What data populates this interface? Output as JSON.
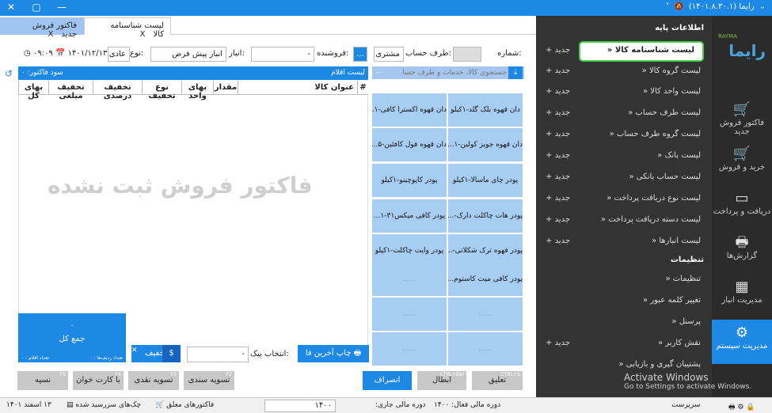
{
  "titlebar": {
    "user": "رایما (۱۴۰۱.۸.۳۰.۱)",
    "icons": [
      "chevron-down-icon",
      "bell-off-icon",
      "chevron-down-small-icon"
    ],
    "window_controls": {
      "close": "✕",
      "maximize": "▢",
      "minimize": "—"
    }
  },
  "logo": {
    "sub": "RAYMA",
    "main": "رایما"
  },
  "rail": [
    {
      "id": "new-invoice",
      "label": "فاکتور فروش جدید",
      "icon": "cart-plus-icon",
      "glyph": "🛒"
    },
    {
      "id": "buy-sell",
      "label": "خرید و فروش",
      "icon": "cart-icon",
      "glyph": "🛒"
    },
    {
      "id": "receive-pay",
      "label": "دریافت و پرداخت",
      "icon": "card-icon",
      "glyph": "▭"
    },
    {
      "id": "reports",
      "label": "گزارش‌ها",
      "icon": "printer-icon",
      "glyph": "🖶"
    },
    {
      "id": "warehouse",
      "label": "مدیریت انبار",
      "icon": "grid-icon",
      "glyph": "▦"
    },
    {
      "id": "system",
      "label": "مدیریت سیستم",
      "icon": "gear-icon",
      "glyph": "⚙"
    }
  ],
  "menu": {
    "section1": "اطلاعات پایه",
    "section2": "تنظیمات",
    "new_label": "جدید",
    "items": [
      {
        "label": "لیست شناسنامه کالا",
        "new": true,
        "selected": true
      },
      {
        "label": "لیست گروه کالا",
        "new": true
      },
      {
        "label": "لیست واحد کالا",
        "new": true
      },
      {
        "label": "لیست طرف حساب",
        "new": true
      },
      {
        "label": "لیست گروه طرف حساب",
        "new": true
      },
      {
        "label": "لیست بانک",
        "new": true
      },
      {
        "label": "لیست حساب بانکی",
        "new": true
      },
      {
        "label": "لیست نوع دریافت پرداخت",
        "new": true
      },
      {
        "label": "لیست دسته دریافت پرداخت",
        "new": true
      },
      {
        "label": "لیست انبارها",
        "new": true
      }
    ],
    "settings": [
      {
        "label": "تنظیمات",
        "new": false
      },
      {
        "label": "تغییر کلمه عبور",
        "new": false
      },
      {
        "label": "پرسنل",
        "new": false
      },
      {
        "label": "نقش کاربر",
        "new": true
      },
      {
        "label": "پشتیبان گیری و بازیابی",
        "new": false
      }
    ]
  },
  "tabs": [
    {
      "label": "فاکتور فروش جدید",
      "close": "X",
      "active": true
    },
    {
      "label": "لیست شناسنامه کالا",
      "close": "X",
      "active": false
    }
  ],
  "form": {
    "number_label": "شماره:",
    "account_label": "طرف حساب:",
    "account_value": "مشتری",
    "seller_label": "فروشنده:",
    "warehouse_label": "انبار:",
    "warehouse_value": "انبار پیش فرض",
    "type_label": "نوع:",
    "type_value": "عادی",
    "date": "۱۴۰۱/۱۲/۱۳",
    "time": "۰۹:۰۹",
    "more_btn": "..."
  },
  "product_search": {
    "placeholder": "جستجوی کالا، خدمات و طرف حساب",
    "more": "..."
  },
  "products": [
    "دان قهوه بلک گلد-۱کیلو",
    "دان قهوه اکسترا کافی-۱...",
    "دان قهوه جویز کولین-۱...",
    "دان قهوه فول کافئین-۵...",
    "پودر چای ماسالا-۱کیلو",
    "پودر کاپوچینو-۱کیلو",
    "پودر هات چاکلت دارک-...",
    "پودر کافی میکس۳۱-۱...",
    "پودر قهوه ترک شکلاتی-...",
    "پودر وایت چاکلت-۱کیلو",
    "پودر کافی میت کاستوم...",
    "......",
    "......",
    "......",
    "......",
    "......"
  ],
  "items": {
    "title": "لیست اقلام",
    "profit": "سود فاکتور: ۰",
    "columns": [
      "#",
      "عنوان کالا",
      "مقدار",
      "بهای واحد",
      "نوع تخفیف",
      "تخفیف درصدی",
      "تخفیف مبلغی",
      "بهای کل"
    ],
    "watermark": "فاکتور فروش ثبت نشده"
  },
  "totals": {
    "value": "۰",
    "label": "جمع کل",
    "rows_count": "تعداد ردیف‌ها : ۰",
    "items_count": "تعداد اقلام : ۰"
  },
  "actions": {
    "print_last": "چاپ آخرین فا",
    "pick_label": "انتخاب پیک:",
    "pick_value": "-",
    "discount": "تخفیف",
    "cancel": "انصراف",
    "void": "ابطال",
    "void_key": "CTRL+Del",
    "suspend": "تعلیق",
    "suspend_key": "CTRL+S",
    "doc_settle": "تسویه سندی",
    "doc_key": "F2",
    "cash_settle": "تسویه نقدی",
    "cash_key": "F3",
    "card_reader": "با کارت خوان",
    "card_key": "F4",
    "credit": "نسیه",
    "credit_key": "F5"
  },
  "status": {
    "user": "سرپرست",
    "active_period": "دوره مالی فعال: ۱۴۰۰",
    "current_period_label": "دوره مالی جاری:",
    "current_period": "۱۴۰۰",
    "pending_invoices": "فاکتورهای معلق",
    "due_cheques": "چک‌های سررسید شده",
    "date": "۱۳ اسفند ۱۴۰۱"
  },
  "os_watermark": {
    "line1": "Activate Windows",
    "line2": "Go to Settings to activate Windows."
  }
}
